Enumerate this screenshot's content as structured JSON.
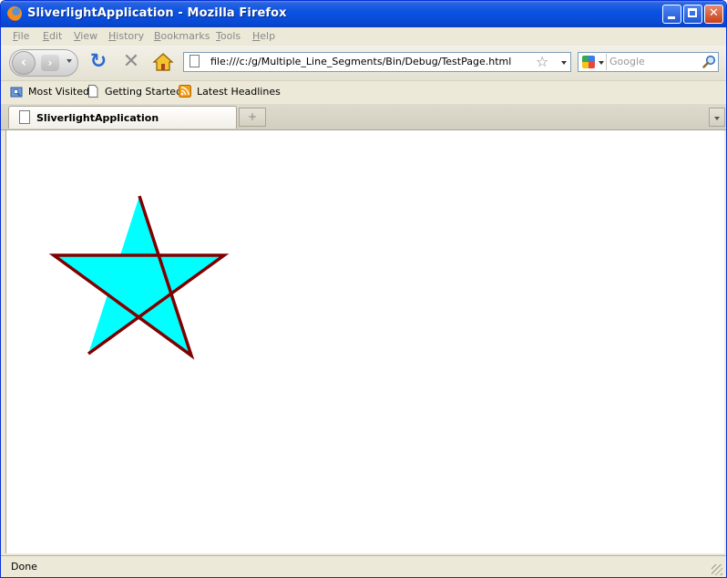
{
  "window": {
    "title": "SliverlightApplication - Mozilla Firefox",
    "minimize_label": "_",
    "maximize_label": "□",
    "close_label": "✕"
  },
  "menu": {
    "items": [
      "File",
      "Edit",
      "View",
      "History",
      "Bookmarks",
      "Tools",
      "Help"
    ]
  },
  "navigation": {
    "back_glyph": "‹",
    "forward_glyph": "›",
    "reload_glyph": "↻",
    "stop_glyph": "✕",
    "url": "file:///c:/g/Multiple_Line_Segments/Bin/Debug/TestPage.html",
    "bookmark_star_glyph": "☆",
    "search_engine": "google-icon",
    "search_placeholder": "Google"
  },
  "bookmarks": {
    "items": [
      {
        "label": "Most Visited",
        "icon": "folder-search-icon"
      },
      {
        "label": "Getting Started",
        "icon": "page-icon"
      },
      {
        "label": "Latest Headlines",
        "icon": "rss-feed-icon"
      }
    ]
  },
  "tabs": {
    "items": [
      {
        "label": "SliverlightApplication",
        "icon": "page-icon"
      }
    ],
    "new_tab_glyph": "+"
  },
  "content": {
    "star": {
      "fill_color": "#00ffff",
      "stroke_color": "#800000"
    }
  },
  "status": {
    "text": "Done"
  },
  "colors": {
    "titlebar": "#0a53e4",
    "window_chrome": "#ece9d8"
  }
}
